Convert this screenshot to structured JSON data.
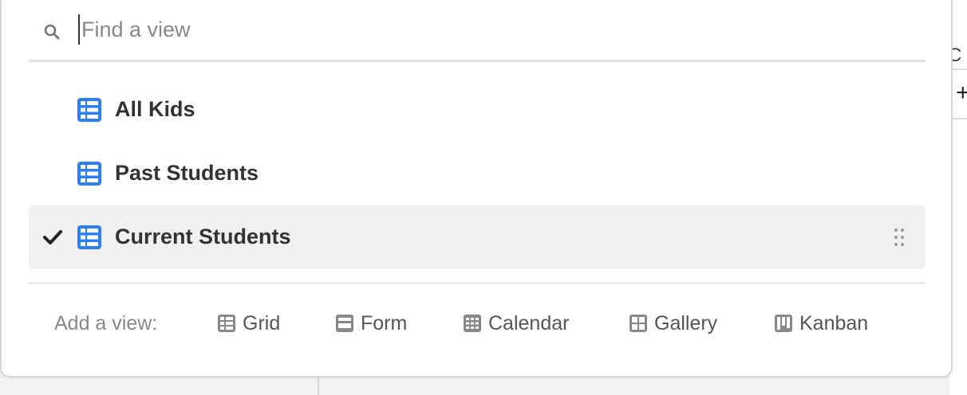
{
  "background": {
    "peek_text": ", C",
    "plus": "+"
  },
  "search": {
    "placeholder": "Find a view",
    "value": ""
  },
  "views": [
    {
      "label": "All Kids",
      "selected": false
    },
    {
      "label": "Past Students",
      "selected": false
    },
    {
      "label": "Current Students",
      "selected": true
    }
  ],
  "add_view": {
    "label": "Add a view:",
    "options": [
      {
        "label": "Grid",
        "icon": "grid-icon"
      },
      {
        "label": "Form",
        "icon": "form-icon"
      },
      {
        "label": "Calendar",
        "icon": "calendar-icon"
      },
      {
        "label": "Gallery",
        "icon": "gallery-icon"
      },
      {
        "label": "Kanban",
        "icon": "kanban-icon"
      }
    ]
  },
  "colors": {
    "view_icon": "#2d7ff9",
    "add_icon": "#888888",
    "selected_bg": "#f0f0f0",
    "text": "#333333"
  }
}
